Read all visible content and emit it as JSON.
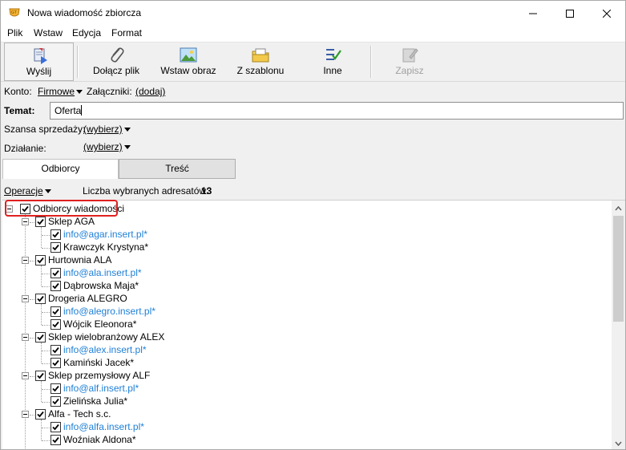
{
  "window": {
    "title": "Nowa wiadomość zbiorcza"
  },
  "menu": [
    "Plik",
    "Wstaw",
    "Edycja",
    "Format"
  ],
  "toolbar": {
    "send": "Wyślij",
    "attach": "Dołącz plik",
    "insert_image": "Wstaw obraz",
    "from_template": "Z szablonu",
    "other": "Inne",
    "save": "Zapisz"
  },
  "account": {
    "label": "Konto:",
    "value": "Firmowe",
    "attachments_label": "Załączniki:",
    "attachments_link": "(dodaj)"
  },
  "subject": {
    "label": "Temat:",
    "value": "Oferta"
  },
  "sales_chance": {
    "label": "Szansa sprzedaży:",
    "value": "(wybierz)"
  },
  "action": {
    "label": "Działanie:",
    "value": "(wybierz)"
  },
  "tabs": {
    "recipients": "Odbiorcy",
    "content": "Treść"
  },
  "operations": {
    "label": "Operacje",
    "count_label": "Liczba wybranych adresatów:",
    "count": "13"
  },
  "tree": {
    "root": "Odbiorcy wiadomości",
    "groups": [
      {
        "name": "Sklep AGA",
        "email": "info@agar.insert.pl*",
        "person": "Krawczyk Krystyna*"
      },
      {
        "name": "Hurtownia ALA",
        "email": "info@ala.insert.pl*",
        "person": "Dąbrowska Maja*"
      },
      {
        "name": "Drogeria ALEGRO",
        "email": "info@alegro.insert.pl*",
        "person": "Wójcik Eleonora*"
      },
      {
        "name": "Sklep wielobranżowy  ALEX",
        "email": "info@alex.insert.pl*",
        "person": "Kamiński Jacek*"
      },
      {
        "name": "Sklep przemysłowy ALF",
        "email": "info@alf.insert.pl*",
        "person": "Zielińska Julia*"
      },
      {
        "name": "Alfa - Tech s.c.",
        "email": "info@alfa.insert.pl*",
        "person": "Woźniak Aldona*"
      }
    ]
  },
  "colors": {
    "email_link": "#1e7fd6",
    "highlight": "#e02020"
  }
}
